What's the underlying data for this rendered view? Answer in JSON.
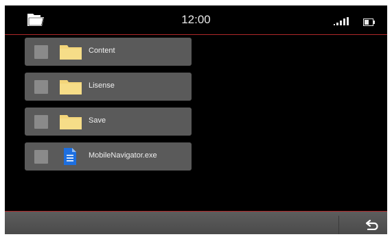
{
  "status_bar": {
    "time": "12:00",
    "folder_icon": "folder-icon",
    "signal_icon": "signal-icon",
    "battery_icon": "battery-icon"
  },
  "file_list": {
    "items": [
      {
        "label": "Content",
        "icon": "folder-icon",
        "checked": false
      },
      {
        "label": "Lisense",
        "icon": "folder-icon",
        "checked": false
      },
      {
        "label": "Save",
        "icon": "folder-icon",
        "checked": false
      },
      {
        "label": "MobileNavigator.exe",
        "icon": "document-icon",
        "checked": false
      }
    ]
  },
  "bottom_bar": {
    "back_icon": "back-icon"
  },
  "colors": {
    "accent_line": "#b0282a",
    "folder": "#f3d57a",
    "document": "#1d6fe0",
    "row_bg": "#5a5a5a"
  }
}
